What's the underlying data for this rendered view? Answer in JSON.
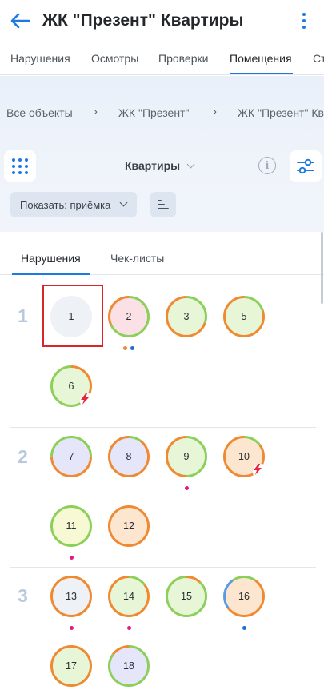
{
  "app": {
    "title": "ЖК \"Презент\" Квартиры"
  },
  "top_tabs": [
    {
      "label": "Нарушения",
      "active": false
    },
    {
      "label": "Осмотры",
      "active": false
    },
    {
      "label": "Проверки",
      "active": false
    },
    {
      "label": "Помещения",
      "active": true
    },
    {
      "label": "Ст",
      "active": false
    }
  ],
  "breadcrumbs": [
    "Все объекты",
    "ЖК \"Презент\"",
    "ЖК \"Презент\" Кв"
  ],
  "breadcrumb_separator": "›",
  "toolbar": {
    "type_select": "Квартиры",
    "info_label": "i",
    "show_filter": "Показать: приёмка"
  },
  "sub_tabs": [
    {
      "label": "Нарушения",
      "active": true
    },
    {
      "label": "Чек-листы",
      "active": false
    }
  ],
  "colors": {
    "accent": "#1f7ae0",
    "ring_green": "#8ccf5a",
    "ring_orange": "#f08a32",
    "ring_blue": "#5b9be6",
    "dot_magenta": "#e3197d",
    "dot_orange": "#f08a32",
    "dot_blue": "#1f6fd1",
    "bolt_red": "#e8263a",
    "fill_grey": "#eef1f5",
    "fill_pink": "#fbe0e6",
    "fill_green": "#e6f6d6",
    "fill_lavender": "#e6e6fa",
    "fill_yellow": "#f6f9d4",
    "fill_peach": "#fde6d0",
    "selection": "#d9262b"
  },
  "floors": [
    {
      "number": "1",
      "units": [
        {
          "number": "1",
          "fill": "#eef1f5",
          "ring": [],
          "dots": [],
          "bolt": false,
          "selected": true
        },
        {
          "number": "2",
          "fill": "#fbe0e6",
          "ring": [
            [
              "#8ccf5a",
              0.68
            ],
            [
              "#f08a32",
              0.32
            ]
          ],
          "dots": [
            "#f08a32",
            "#1f6fd1"
          ],
          "bolt": false
        },
        {
          "number": "3",
          "fill": "#e6f6d6",
          "ring": [
            [
              "#8ccf5a",
              0.3
            ],
            [
              "#f08a32",
              0.7
            ]
          ],
          "dots": [],
          "bolt": false
        },
        {
          "number": "5",
          "fill": "#e6f6d6",
          "ring": [
            [
              "#8ccf5a",
              0.2
            ],
            [
              "#f08a32",
              0.8
            ]
          ],
          "dots": [],
          "bolt": false
        },
        {
          "number": "6",
          "fill": "#e6f6d6",
          "ring": [
            [
              "#f08a32",
              0.35
            ],
            [
              "#8ccf5a",
              0.65
            ]
          ],
          "dots": [],
          "bolt": true
        }
      ]
    },
    {
      "number": "2",
      "units": [
        {
          "number": "7",
          "fill": "#e6e6fa",
          "ring": [
            [
              "#8ccf5a",
              0.25
            ],
            [
              "#f08a32",
              0.5
            ],
            [
              "#8ccf5a",
              0.25
            ]
          ],
          "dots": [],
          "bolt": false
        },
        {
          "number": "8",
          "fill": "#e6e6fa",
          "ring": [
            [
              "#8ccf5a",
              0.1
            ],
            [
              "#f08a32",
              0.9
            ]
          ],
          "dots": [],
          "bolt": false
        },
        {
          "number": "9",
          "fill": "#e6f6d6",
          "ring": [
            [
              "#8ccf5a",
              0.5
            ],
            [
              "#f08a32",
              0.5
            ]
          ],
          "dots": [
            "#e3197d"
          ],
          "bolt": false
        },
        {
          "number": "10",
          "fill": "#fde6d0",
          "ring": [
            [
              "#8ccf5a",
              0.15
            ],
            [
              "#f08a32",
              0.85
            ]
          ],
          "dots": [],
          "bolt": true
        },
        {
          "number": "11",
          "fill": "#f6f9d4",
          "ring": [
            [
              "#8ccf5a",
              1.0
            ]
          ],
          "dots": [
            "#e3197d"
          ],
          "bolt": false
        },
        {
          "number": "12",
          "fill": "#fde6d0",
          "ring": [
            [
              "#f08a32",
              1.0
            ]
          ],
          "dots": [],
          "bolt": false
        }
      ]
    },
    {
      "number": "3",
      "units": [
        {
          "number": "13",
          "fill": "#eef1f5",
          "ring": [
            [
              "#f08a32",
              1.0
            ]
          ],
          "dots": [
            "#e3197d"
          ],
          "bolt": false
        },
        {
          "number": "14",
          "fill": "#e6f6d6",
          "ring": [
            [
              "#8ccf5a",
              0.15
            ],
            [
              "#f08a32",
              0.85
            ]
          ],
          "dots": [
            "#e3197d"
          ],
          "bolt": false
        },
        {
          "number": "15",
          "fill": "#e6f6d6",
          "ring": [
            [
              "#f08a32",
              0.12
            ],
            [
              "#8ccf5a",
              0.88
            ]
          ],
          "dots": [],
          "bolt": false
        },
        {
          "number": "16",
          "fill": "#fde6d0",
          "ring": [
            [
              "#8ccf5a",
              0.1
            ],
            [
              "#f08a32",
              0.55
            ],
            [
              "#5b9be6",
              0.25
            ],
            [
              "#8ccf5a",
              0.1
            ]
          ],
          "dots": [
            "#1f6fd1"
          ],
          "bolt": false
        },
        {
          "number": "17",
          "fill": "#e6f6d6",
          "ring": [
            [
              "#f08a32",
              1.0
            ]
          ],
          "dots": [],
          "bolt": false
        },
        {
          "number": "18",
          "fill": "#e6e6fa",
          "ring": [
            [
              "#8ccf5a",
              0.85
            ],
            [
              "#f08a32",
              0.15
            ]
          ],
          "dots": [],
          "bolt": false
        }
      ]
    }
  ]
}
